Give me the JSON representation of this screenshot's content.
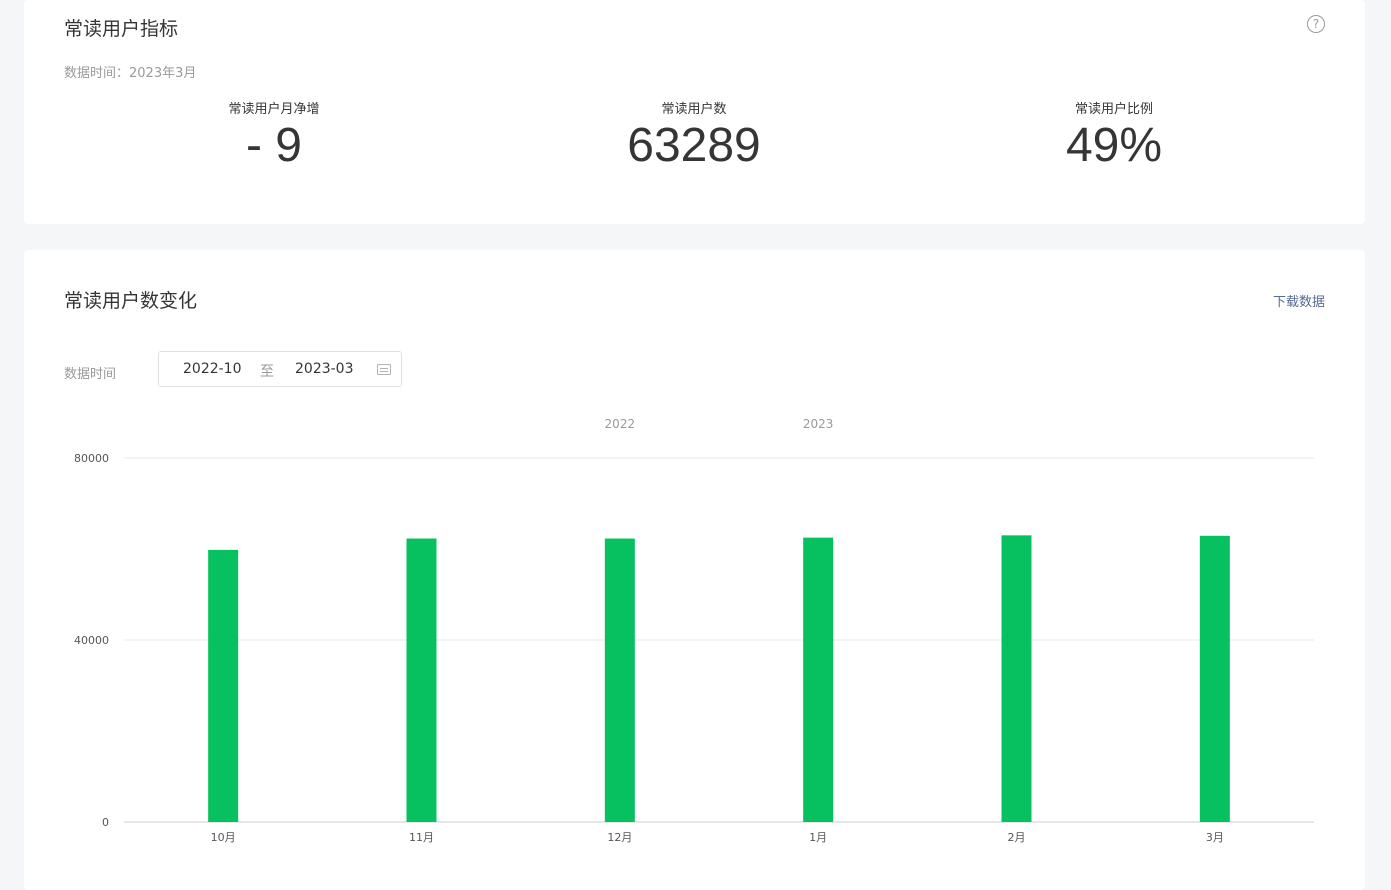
{
  "metrics": {
    "title": "常读用户指标",
    "help_icon": "help-circle-icon",
    "data_time": "数据时间：2023年3月",
    "items": [
      {
        "label": "常读用户月净增",
        "value": "- 9"
      },
      {
        "label": "常读用户数",
        "value": "63289"
      },
      {
        "label": "常读用户比例",
        "value": "49%"
      }
    ]
  },
  "chart_section": {
    "title": "常读用户数变化",
    "download_label": "下载数据",
    "date_label": "数据时间",
    "date_start": "2022-10",
    "date_sep": "至",
    "date_end": "2023-03",
    "calendar_icon": "calendar-icon"
  },
  "chart_data": {
    "type": "bar",
    "categories": [
      "10月",
      "11月",
      "12月",
      "1月",
      "2月",
      "3月"
    ],
    "year_labels": [
      {
        "text": "2022",
        "at": "12月"
      },
      {
        "text": "2023",
        "at": "1月"
      }
    ],
    "values": [
      59800,
      62300,
      62300,
      62500,
      63000,
      62900
    ],
    "ylim": [
      0,
      80000
    ],
    "yticks": [
      0,
      40000,
      80000
    ],
    "bar_color": "#07c160",
    "grid": true,
    "legend": "none"
  }
}
